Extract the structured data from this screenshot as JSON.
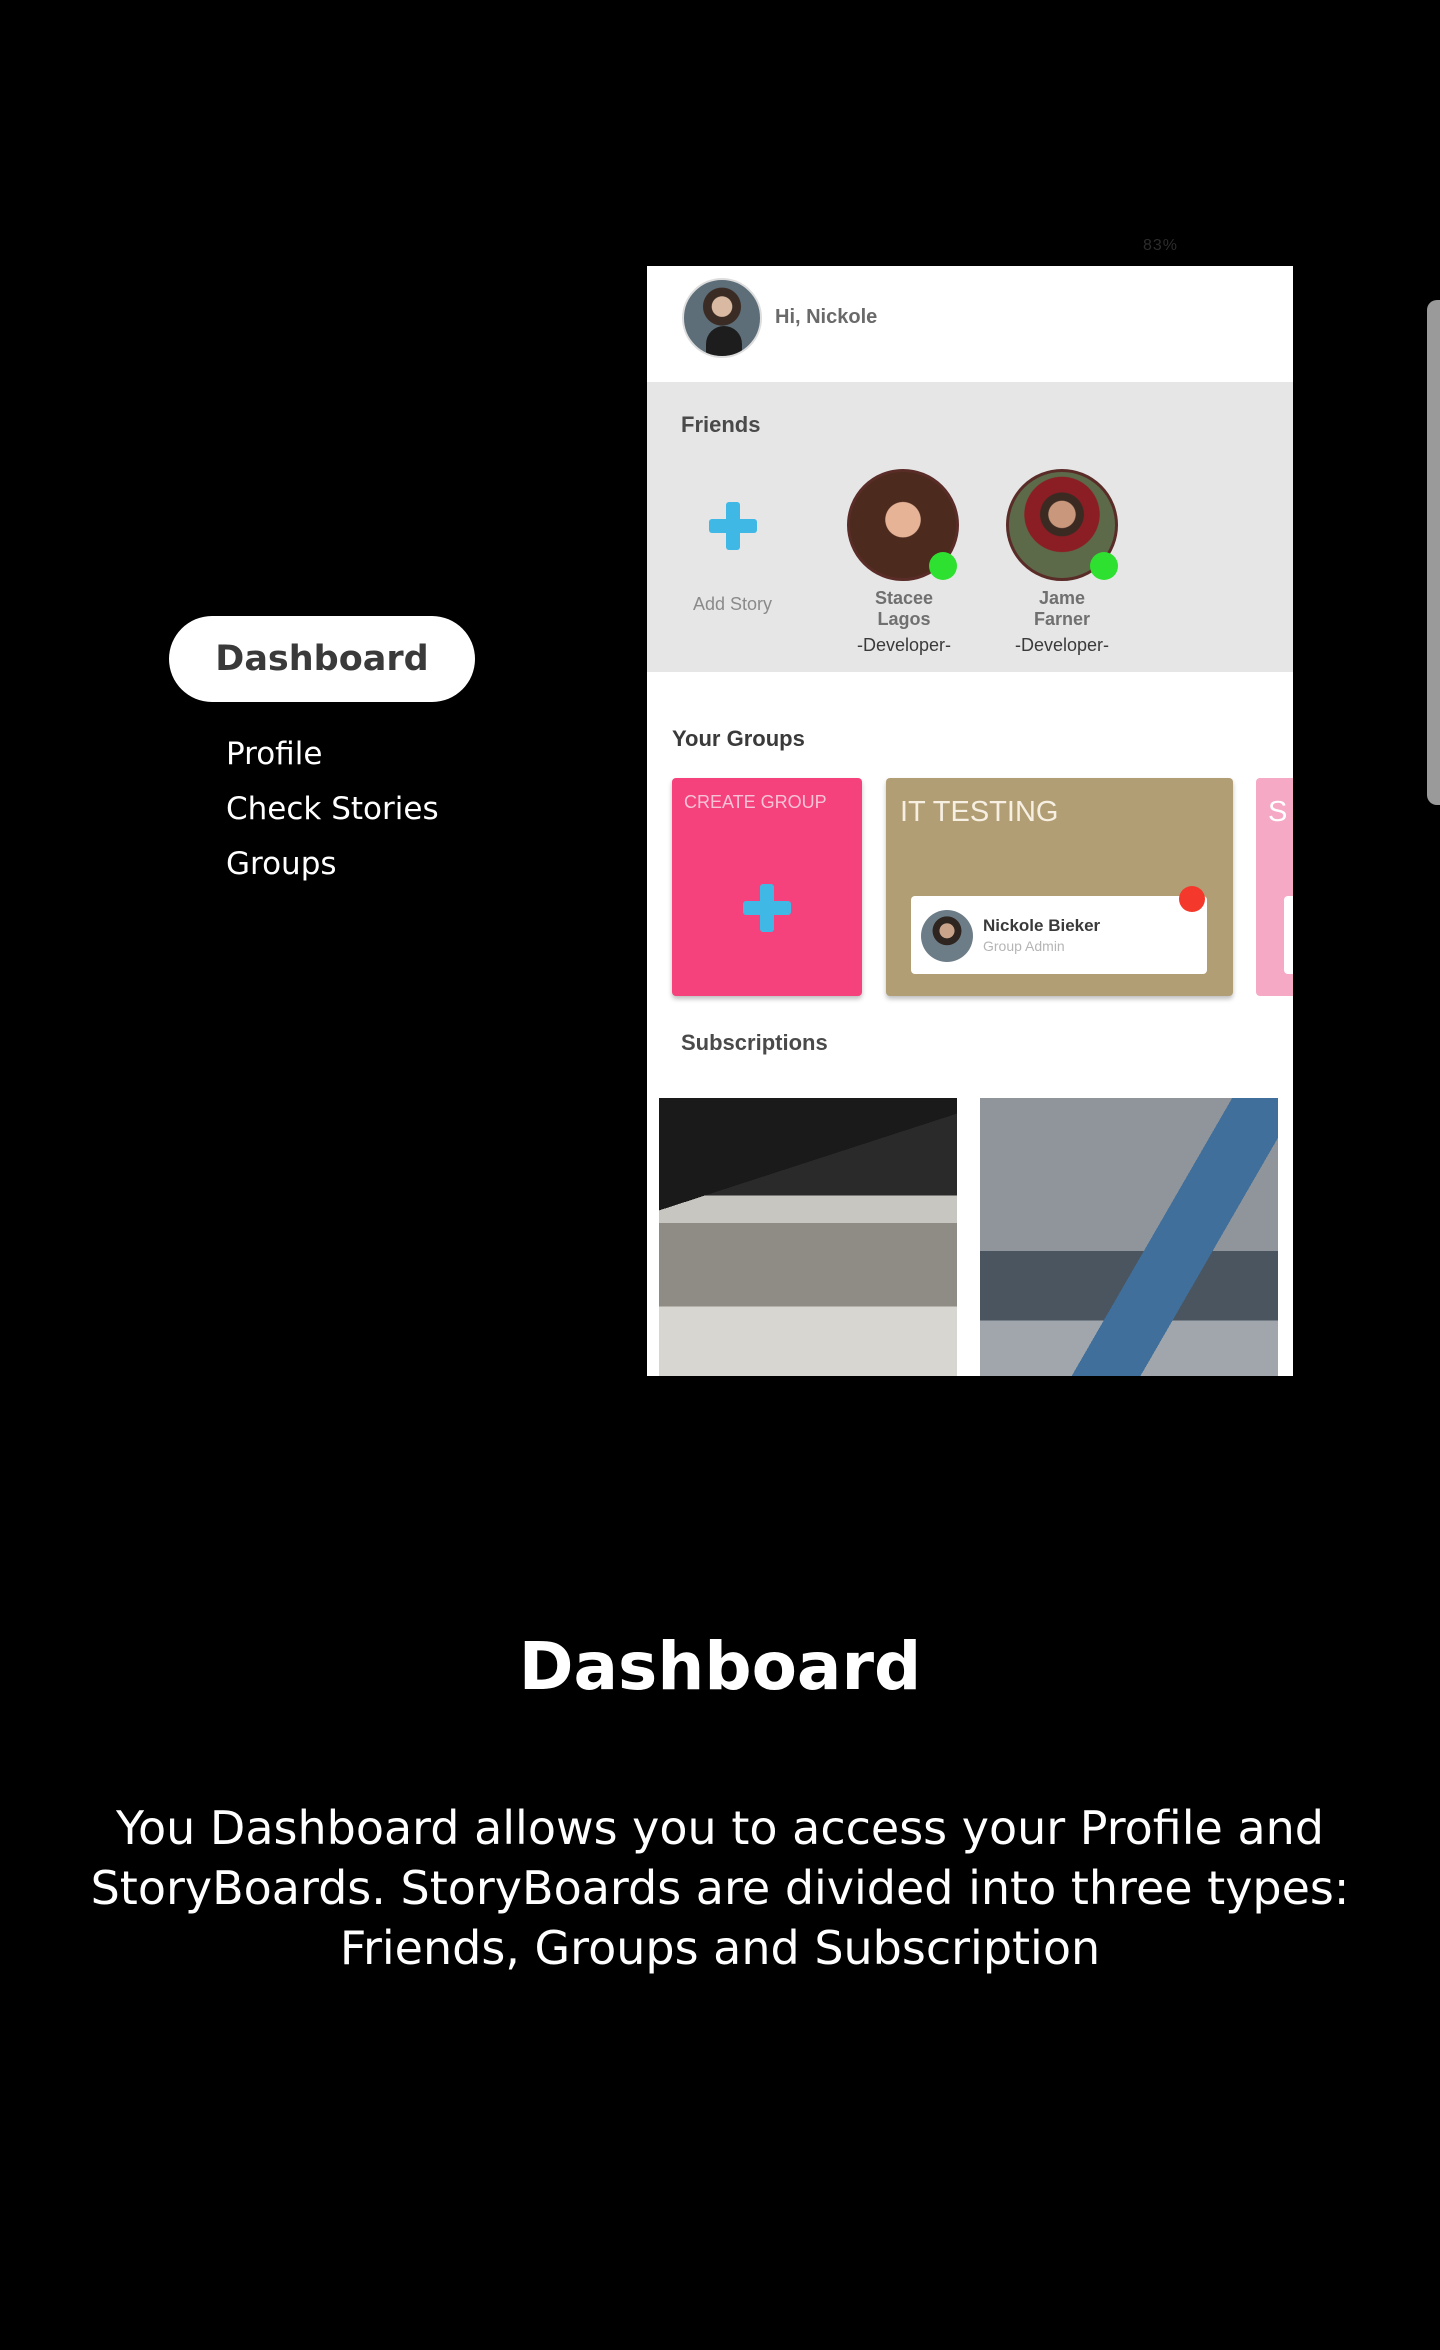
{
  "status": {
    "battery": "83%"
  },
  "side_menu": {
    "active": "Dashboard",
    "items": [
      "Profile",
      "Check Stories",
      "Groups"
    ]
  },
  "phone": {
    "greeting": "Hi, Nickole",
    "friends": {
      "title": "Friends",
      "add_story": "Add Story",
      "people": [
        {
          "name_line1": "Stacee",
          "name_line2": "Lagos",
          "role": "-Developer-"
        },
        {
          "name_line1": "Jame",
          "name_line2": "Farner",
          "role": "-Developer-"
        }
      ]
    },
    "groups": {
      "title": "Your Groups",
      "create_label": "CREATE GROUP",
      "group_name": "IT TESTING",
      "admin_name": "Nickole Bieker",
      "admin_role": "Group Admin",
      "third_label": "S"
    },
    "subscriptions": {
      "title": "Subscriptions"
    }
  },
  "caption": {
    "title": "Dashboard",
    "text": "You Dashboard allows you to access your Profile and StoryBoards. StoryBoards are divided into three types: Friends, Groups and Subscription"
  },
  "colors": {
    "create_card": "#f5417c",
    "group_card": "#b19e74",
    "plus": "#3fb8e6",
    "online": "#2ee030",
    "notification": "#f4392c"
  }
}
